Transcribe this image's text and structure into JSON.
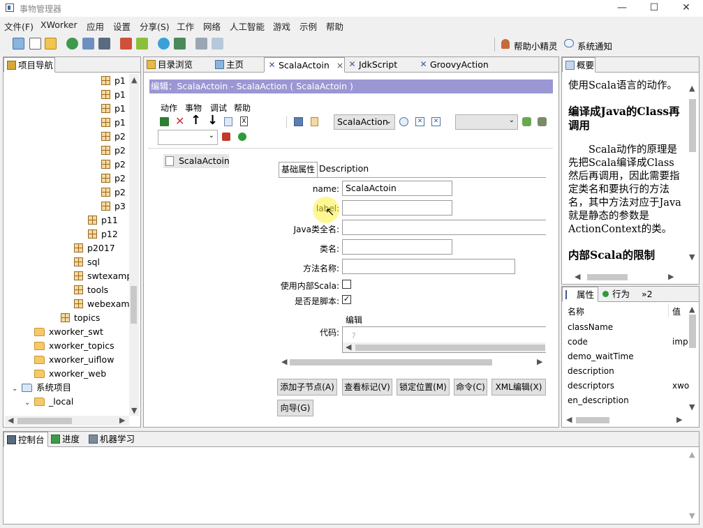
{
  "window": {
    "title": "事物管理器",
    "minimize": "—",
    "maximize": "☐",
    "close": "✕"
  },
  "menu": [
    "文件(F)",
    "XWorker",
    "应用",
    "设置",
    "分享(S)",
    "工作",
    "网络",
    "人工智能",
    "游戏",
    "示例",
    "帮助"
  ],
  "toolbar_right": {
    "helper": "帮助小精灵",
    "notify": "系统通知"
  },
  "left_panel": {
    "tab": "项目导航",
    "items": [
      {
        "label": "p1",
        "kind": "pkg"
      },
      {
        "label": "p1",
        "kind": "pkg"
      },
      {
        "label": "p1",
        "kind": "pkg"
      },
      {
        "label": "p1",
        "kind": "pkg"
      },
      {
        "label": "p2",
        "kind": "pkg"
      },
      {
        "label": "p2",
        "kind": "pkg"
      },
      {
        "label": "p2",
        "kind": "pkg"
      },
      {
        "label": "p2",
        "kind": "pkg"
      },
      {
        "label": "p2",
        "kind": "pkg"
      },
      {
        "label": "p3",
        "kind": "pkg"
      },
      {
        "label": "p11",
        "kind": "pkg"
      },
      {
        "label": "p12",
        "kind": "pkg"
      },
      {
        "label": "p2017",
        "kind": "pkg"
      },
      {
        "label": "sql",
        "kind": "pkg"
      },
      {
        "label": "swtexamp",
        "kind": "pkg"
      },
      {
        "label": "tools",
        "kind": "pkg"
      },
      {
        "label": "webexam",
        "kind": "pkg"
      },
      {
        "label": "topics",
        "kind": "pkg"
      },
      {
        "label": "xworker_swt",
        "kind": "folder"
      },
      {
        "label": "xworker_topics",
        "kind": "folder"
      },
      {
        "label": "xworker_uiflow",
        "kind": "folder"
      },
      {
        "label": "xworker_web",
        "kind": "folder"
      },
      {
        "label": "系统项目",
        "kind": "sysfolder"
      },
      {
        "label": "_local",
        "kind": "folder"
      }
    ]
  },
  "editor": {
    "tabs": [
      "目录浏览",
      "主页",
      "ScalaActoin",
      "JdkScript",
      "GroovyAction"
    ],
    "tab_close": "×",
    "header": "编辑：ScalaActoin - ScalaAction ( ScalaActoin )",
    "submenu": [
      "动作",
      "事物",
      "调试",
      "帮助"
    ],
    "combo1": "ScalaAction",
    "outline_node": "ScalaActoin",
    "prop_tabs": [
      "基础属性",
      "Description"
    ],
    "fields": {
      "name_label": "name:",
      "name_value": "ScalaActoin",
      "label_label": "label:",
      "label_value": "",
      "java_label": "Java类全名:",
      "java_value": "",
      "class_label": "类名:",
      "class_value": "",
      "method_label": "方法名称:",
      "method_value": "",
      "use_inner_label": "使用内部Scala:",
      "is_script_label": "是否是脚本:",
      "edit_link": "编辑",
      "code_label": "代码:",
      "code_line": "7"
    },
    "buttons": [
      "添加子节点(A)",
      "查看标记(V)",
      "锁定位置(M)",
      "命令(C)",
      "XML编辑(X)",
      "向导(G)"
    ]
  },
  "summary": {
    "tab": "概要",
    "p1": "使用Scala语言的动作。",
    "h1": "编译成Java的Class再调用",
    "p2": "Scala动作的原理是先把Scala编译成Class然后再调用，因此需要指定类名和要执行的方法名，其中方法对应于Java就是静态的参数是ActionContext的类。",
    "h2": "内部Scala的限制"
  },
  "props": {
    "tabs": [
      "属性",
      "行为",
      "»2"
    ],
    "col_name": "名称",
    "col_value": "值",
    "rows": [
      {
        "name": "className",
        "value": ""
      },
      {
        "name": "code",
        "value": "imp"
      },
      {
        "name": "demo_waitTime",
        "value": ""
      },
      {
        "name": "description",
        "value": ""
      },
      {
        "name": "descriptors",
        "value": "xwo"
      },
      {
        "name": "en_description",
        "value": ""
      }
    ]
  },
  "bottom": {
    "tabs": [
      "控制台",
      "进度",
      "机器学习"
    ]
  }
}
